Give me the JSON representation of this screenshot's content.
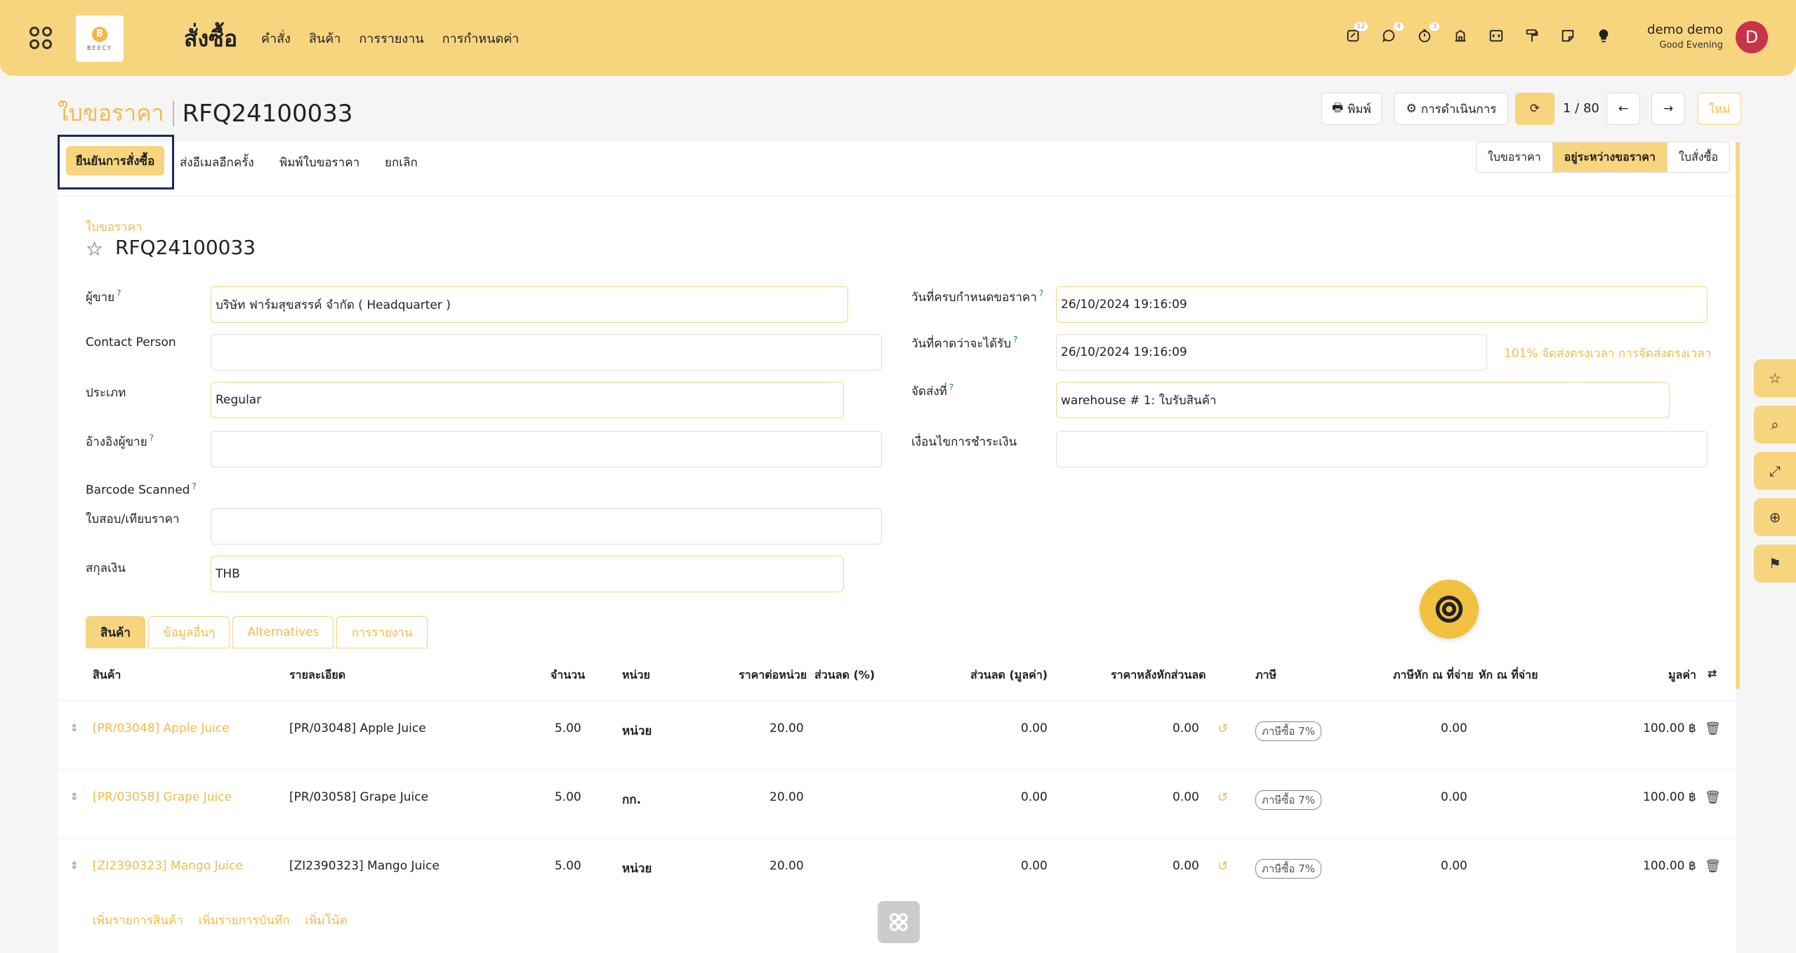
{
  "navbar": {
    "logo_text": "BEECY",
    "app_title": "สั่งซื้อ",
    "menu": [
      "คำสั่ง",
      "สินค้า",
      "การรายงาน",
      "การกำหนดค่า"
    ],
    "badges": {
      "activity": "12",
      "messages": "4",
      "timer": "3"
    },
    "user_name": "demo demo",
    "greeting": "Good Evening",
    "avatar_letter": "D"
  },
  "header": {
    "breadcrumb_parent": "ใบขอราคา",
    "breadcrumb_current": "RFQ24100033",
    "print_label": "พิมพ์",
    "actions_label": "การดำเนินการ",
    "pager": "1 / 80",
    "new_label": "ใหม่"
  },
  "status_bar": {
    "confirm_label": "ยืนยันการสั่งซื้อ",
    "resend_label": "ส่งอีเมลอีกครั้ง",
    "print_rfq_label": "พิมพ์ใบขอราคา",
    "cancel_label": "ยกเลิก",
    "stages": [
      "ใบขอราคา",
      "อยู่ระหว่างขอราคา",
      "ใบสั่งซื้อ"
    ],
    "active_stage": "อยู่ระหว่างขอราคา"
  },
  "form": {
    "record_label": "ใบขอราคา",
    "record_name": "RFQ24100033",
    "vendor_label": "ผู้ขาย",
    "vendor_value": "บริษัท ฟาร์มสุขสรรค์ จำกัด ( Headquarter )",
    "contact_label": "Contact Person",
    "contact_value": "",
    "type_label": "ประเภท",
    "type_value": "Regular",
    "vendor_ref_label": "อ้างอิงผู้ขาย",
    "vendor_ref_value": "",
    "barcode_label": "Barcode Scanned",
    "quote_compare_label": "ใบสอบ/เทียบราคา",
    "quote_compare_value": "",
    "currency_label": "สกุลเงิน",
    "currency_value": "THB",
    "deadline_label": "วันที่ครบกำหนดขอราคา",
    "deadline_value": "26/10/2024 19:16:09",
    "expected_label": "วันที่คาดว่าจะได้รับ",
    "expected_value": "26/10/2024 19:16:09",
    "ontime_hint": "101% จัดส่งตรงเวลา การจัดส่งตรงเวลา",
    "deliver_to_label": "จัดส่งที่",
    "deliver_to_value": "warehouse # 1: ใบรับสินค้า",
    "payment_terms_label": "เงื่อนไขการชำระเงิน",
    "payment_terms_value": ""
  },
  "tabs": [
    "สินค้า",
    "ข้อมูลอื่นๆ",
    "Alternatives",
    "การรายงาน"
  ],
  "table": {
    "headers": {
      "product": "สินค้า",
      "description": "รายละเอียด",
      "qty": "จำนวน",
      "uom": "หน่วย",
      "unit_price": "ราคาต่อหน่วย",
      "discount_pct": "ส่วนลด (%)",
      "discount_amt": "ส่วนลด (มูลค่า)",
      "price_after": "ราคาหลังหักส่วนลด",
      "tax": "ภาษี",
      "wht": "ภาษีหัก ณ ที่จ่าย",
      "wht2": "หัก ณ ที่จ่าย",
      "amount": "มูลค่า"
    },
    "rows": [
      {
        "product": "[PR/03048] Apple Juice",
        "description": "[PR/03048] Apple Juice",
        "qty": "5.00",
        "uom": "หน่วย",
        "unit_price": "20.00",
        "discount_amt": "0.00",
        "price_after": "0.00",
        "tax": "ภาษีซื้อ 7%",
        "wht": "0.00",
        "amount": "100.00 ฿"
      },
      {
        "product": "[PR/03058] Grape Juice",
        "description": "[PR/03058] Grape Juice",
        "qty": "5.00",
        "uom": "กก.",
        "unit_price": "20.00",
        "discount_amt": "0.00",
        "price_after": "0.00",
        "tax": "ภาษีซื้อ 7%",
        "wht": "0.00",
        "amount": "100.00 ฿"
      },
      {
        "product": "[ZI2390323] Mango Juice",
        "description": "[ZI2390323] Mango Juice",
        "qty": "5.00",
        "uom": "หน่วย",
        "unit_price": "20.00",
        "discount_amt": "0.00",
        "price_after": "0.00",
        "tax": "ภาษีซื้อ 7%",
        "wht": "0.00",
        "amount": "100.00 ฿"
      }
    ],
    "add_product": "เพิ่มรายการสินค้า",
    "add_section": "เพิ่มรายการบันทึก",
    "add_note": "เพิ่มโน้ต"
  }
}
